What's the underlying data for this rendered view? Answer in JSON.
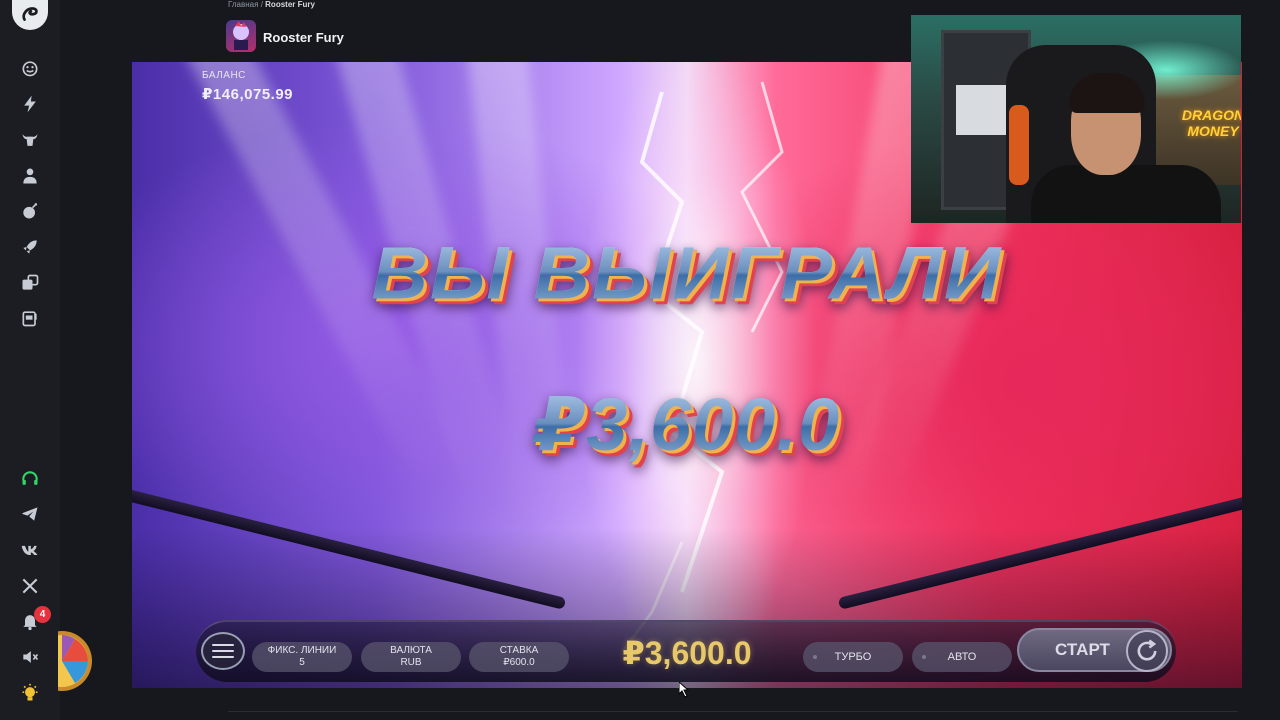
{
  "breadcrumb": {
    "home": "Главная",
    "separator": "/",
    "current": "Rooster Fury"
  },
  "game": {
    "title": "Rooster Fury"
  },
  "balance": {
    "label": "БАЛАНС",
    "value": "₽146,075.99"
  },
  "win": {
    "title": "ВЫ ВЫИГРАЛИ",
    "amount": "₽3,600.0"
  },
  "controls": {
    "lines_label": "ФИКС. ЛИНИИ",
    "lines_value": "5",
    "currency_label": "ВАЛЮТА",
    "currency_value": "RUB",
    "bet_label": "СТАВКА",
    "bet_value": "₽600.0",
    "total": "₽3,600.0",
    "turbo_label": "ТУРБО",
    "auto_label": "АВТО",
    "start_label": "СТАРТ"
  },
  "sidebar": {
    "notification_count": "4"
  },
  "webcam": {
    "neon_sign": "DRAGON MONEY"
  },
  "colors": {
    "accent_green": "#35d46a",
    "badge_red": "#e5323e",
    "gold": "#e8c96a"
  }
}
